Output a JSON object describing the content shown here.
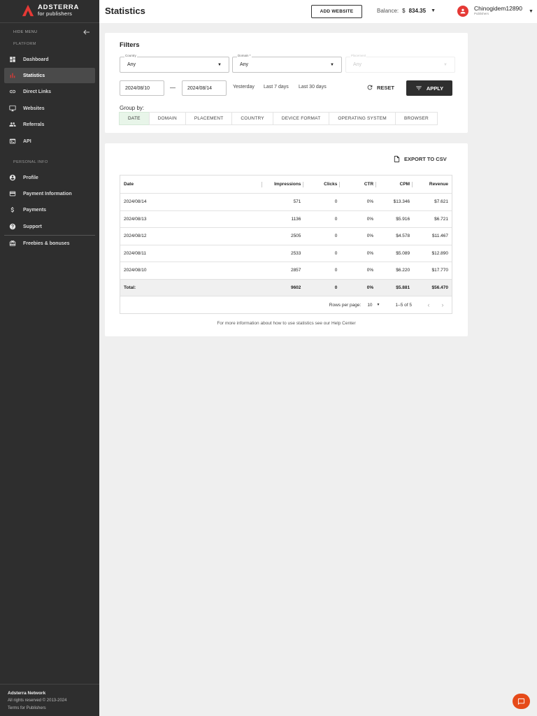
{
  "brand": {
    "line1": "ADSTERRA",
    "line2": "for publishers",
    "accent": "#e53935"
  },
  "sidebar": {
    "hide_menu": "HIDE MENU",
    "platform_label": "PLATFORM",
    "platform_items": [
      {
        "label": "Dashboard",
        "icon": "dashboard-icon"
      },
      {
        "label": "Statistics",
        "icon": "bar-chart-icon",
        "active": true
      },
      {
        "label": "Direct Links",
        "icon": "link-icon"
      },
      {
        "label": "Websites",
        "icon": "monitor-icon"
      },
      {
        "label": "Referrals",
        "icon": "people-icon"
      },
      {
        "label": "API",
        "icon": "terminal-icon"
      }
    ],
    "personal_label": "PERSONAL INFO",
    "personal_items": [
      {
        "label": "Profile",
        "icon": "profile-icon"
      },
      {
        "label": "Payment Information",
        "icon": "credit-card-icon"
      },
      {
        "label": "Payments",
        "icon": "dollar-icon"
      },
      {
        "label": "Support",
        "icon": "help-icon"
      }
    ],
    "extra_items": [
      {
        "label": "Freebies & bonuses",
        "icon": "gift-icon"
      }
    ],
    "footer": {
      "title": "Adsterra Network",
      "rights": "All rights reserved © 2013-2024",
      "terms": "Terms for Publishers"
    }
  },
  "header": {
    "title": "Statistics",
    "add_website": "ADD WEBSITE",
    "balance_label": "Balance:",
    "currency": "$",
    "balance_amount": "834.35",
    "username": "Chinogidem12890",
    "role": "Publishers"
  },
  "filters": {
    "title": "Filters",
    "country": {
      "label": "Country",
      "value": "Any"
    },
    "domain": {
      "label": "Domain *",
      "value": "Any"
    },
    "placement": {
      "label": "Placement",
      "value": "Any"
    },
    "date_from": "2024/08/10",
    "date_to": "2024/08/14",
    "separator": "—",
    "quick": [
      "Yesterday",
      "Last 7 days",
      "Last 30 days"
    ],
    "reset": "RESET",
    "apply": "APPLY",
    "group_by_label": "Group by:",
    "group_by": [
      "DATE",
      "DOMAIN",
      "PLACEMENT",
      "COUNTRY",
      "DEVICE FORMAT",
      "OPERATING SYSTEM",
      "BROWSER"
    ]
  },
  "results": {
    "export": "EXPORT TO CSV",
    "columns": [
      "Date",
      "Impressions",
      "Clicks",
      "CTR",
      "CPM",
      "Revenue"
    ],
    "rows": [
      [
        "2024/08/14",
        "571",
        "0",
        "0%",
        "$13.346",
        "$7.621"
      ],
      [
        "2024/08/13",
        "1136",
        "0",
        "0%",
        "$5.916",
        "$6.721"
      ],
      [
        "2024/08/12",
        "2505",
        "0",
        "0%",
        "$4.578",
        "$11.467"
      ],
      [
        "2024/08/11",
        "2533",
        "0",
        "0%",
        "$5.089",
        "$12.890"
      ],
      [
        "2024/08/10",
        "2857",
        "0",
        "0%",
        "$6.220",
        "$17.770"
      ]
    ],
    "total": [
      "Total:",
      "9602",
      "0",
      "0%",
      "$5.881",
      "$56.470"
    ],
    "rows_per_page_label": "Rows per page:",
    "rows_per_page": "10",
    "range": "1–5 of 5",
    "help_text": "For more information about how to use statistics see our Help Center"
  }
}
